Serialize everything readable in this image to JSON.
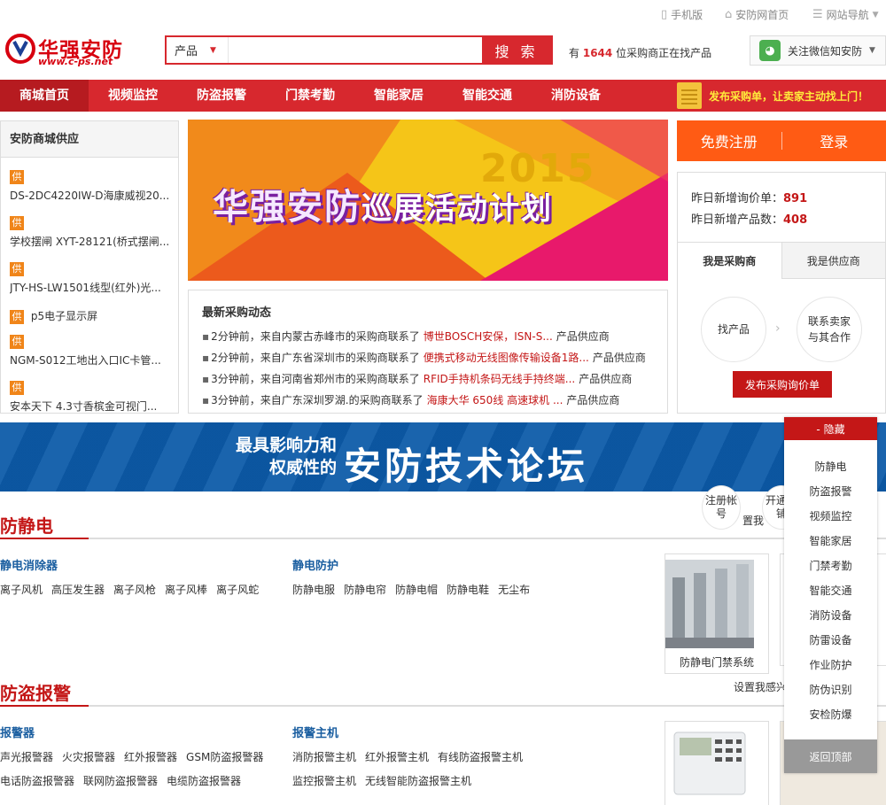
{
  "topbar": {
    "mobile": "手机版",
    "home": "安防网首页",
    "sitenav": "网站导航"
  },
  "header": {
    "logo_cn": "华强安防",
    "logo_url": "www.c-ps.net",
    "search_category": "产品",
    "search_placeholder": "",
    "search_button": "搜 索",
    "buyer_prefix": "有",
    "buyer_count": "1644",
    "buyer_suffix": "位采购商正在找产品",
    "wechat": "关注微信知安防"
  },
  "nav": {
    "items": [
      "商城首页",
      "视频监控",
      "防盗报警",
      "门禁考勤",
      "智能家居",
      "智能交通",
      "消防设备"
    ],
    "promo": "发布采购单，让卖家主动找上门！"
  },
  "supply": {
    "title": "安防商城供应",
    "tag": "供",
    "items": [
      "DS-2DC4220IW-D海康威视20...",
      "学校摆闸 XYT-28121(桥式摆闸...",
      "JTY-HS-LW1501线型(红外)光...",
      "p5电子显示屏",
      "NGM-S012工地出入口IC卡管...",
      "安本天下 4.3寸香槟金可视门..."
    ]
  },
  "banner": {
    "title_main": "华强安防",
    "title_sub": "巡展活动计划",
    "year": "2015"
  },
  "latest": {
    "title": "最新采购动态",
    "rows": [
      {
        "prefix": "2分钟前，来自内蒙古赤峰市的采购商联系了",
        "highlight": "博世BOSCH安保，ISN-S...",
        "suffix": "产品供应商"
      },
      {
        "prefix": "2分钟前，来自广东省深圳市的采购商联系了",
        "highlight": "便携式移动无线图像传输设备1路...",
        "suffix": "产品供应商"
      },
      {
        "prefix": "3分钟前，来自河南省郑州市的采购商联系了",
        "highlight": "RFID手持机条码无线手持终端...",
        "suffix": "产品供应商"
      },
      {
        "prefix": "3分钟前，来自广东深圳罗湖.的采购商联系了",
        "highlight": "海康大华 650线 高速球机 ...",
        "suffix": "产品供应商"
      }
    ]
  },
  "account": {
    "register": "免费注册",
    "login": "登录",
    "inquiries_label": "昨日新增询价单：",
    "inquiries_value": "891",
    "products_label": "昨日新增产品数：",
    "products_value": "408",
    "tab_buyer": "我是采购商",
    "tab_supplier": "我是供应商",
    "step1": "找产品",
    "step2": "联系卖家与其合作",
    "post_button": "发布采购询价单"
  },
  "forum": {
    "small": "最具影响力和权威性的",
    "big": "安防技术论坛"
  },
  "side_buttons": {
    "register": "注册帐号",
    "open": "开通旺铺",
    "setup": "置我"
  },
  "sections": [
    {
      "title": "防静电",
      "groups": [
        {
          "title": "静电消除器",
          "rows": [
            [
              "离子风机",
              "高压发生器",
              "离子风枪",
              "离子风棒",
              "离子风蛇"
            ]
          ]
        },
        {
          "title": "静电防护",
          "rows": [
            [
              "防静电服",
              "防静电帘",
              "防静电帽",
              "防静电鞋",
              "无尘布"
            ]
          ]
        }
      ],
      "product": "防静电门禁系统",
      "extra": ""
    },
    {
      "title": "防盗报警",
      "groups": [
        {
          "title": "报警器",
          "rows": [
            [
              "声光报警器",
              "火灾报警器",
              "红外报警器",
              "GSM防盗报警器"
            ],
            [
              "电话防盗报警器",
              "联网防盗报警器",
              "电缆防盗报警器"
            ]
          ]
        },
        {
          "title": "报警主机",
          "rows": [
            [
              "消防报警主机",
              "红外报警主机",
              "有线防盗报警主机"
            ],
            [
              "监控报警主机",
              "无线智能防盗报警主机"
            ]
          ]
        }
      ],
      "product": "",
      "extra": "设置我感兴"
    }
  ],
  "floatnav": {
    "hide": "- 隐藏",
    "items": [
      "防静电",
      "防盗报警",
      "视频监控",
      "智能家居",
      "门禁考勤",
      "智能交通",
      "消防设备",
      "防雷设备",
      "作业防护",
      "防伪识别",
      "安检防爆"
    ],
    "back_top": "返回顶部"
  },
  "colors": {
    "brand_red": "#d7282e",
    "accent_orange": "#ff5b14",
    "link_blue": "#1a5ea0"
  }
}
